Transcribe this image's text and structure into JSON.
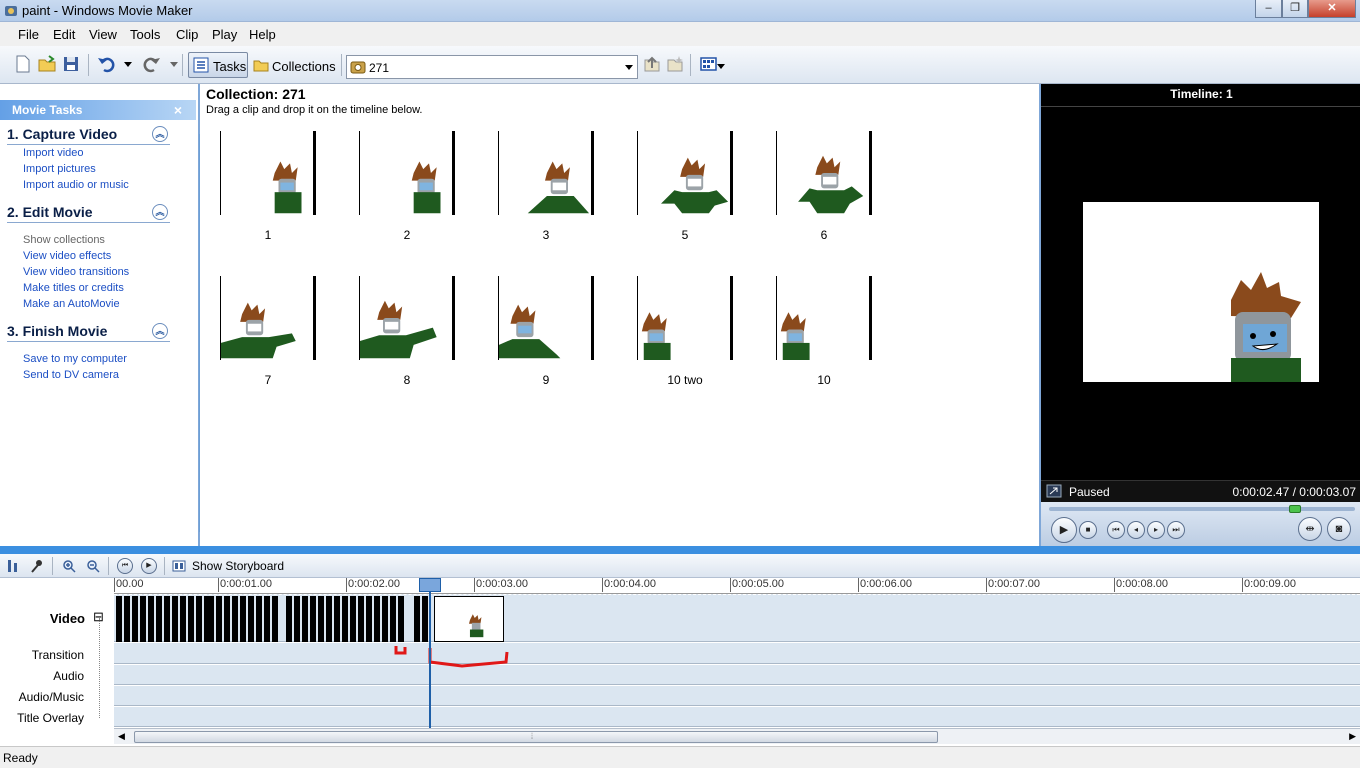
{
  "window": {
    "title": "paint - Windows Movie Maker"
  },
  "menu": [
    "File",
    "Edit",
    "View",
    "Tools",
    "Clip",
    "Play",
    "Help"
  ],
  "toolbar": {
    "tasks_label": "Tasks",
    "collections_label": "Collections",
    "collection_value": "271"
  },
  "task_pane": {
    "header": "Movie Tasks",
    "close": "×",
    "sections": [
      {
        "title": "1. Capture Video",
        "links": [
          "Import video",
          "Import pictures",
          "Import audio or music"
        ]
      },
      {
        "title": "2. Edit Movie",
        "links": [
          "Show collections",
          "View video effects",
          "View video transitions",
          "Make titles or credits",
          "Make an AutoMovie"
        ]
      },
      {
        "title": "3. Finish Movie",
        "links": [
          "Save to my computer",
          "Send to DV camera"
        ]
      }
    ]
  },
  "collection": {
    "title": "Collection: 271",
    "subtitle": "Drag a clip and drop it on the timeline below.",
    "clips": [
      "1",
      "2",
      "3",
      "5",
      "6",
      "7",
      "8",
      "9",
      "10 two",
      "10"
    ]
  },
  "monitor": {
    "title": "Timeline: 1",
    "status": "Paused",
    "time": "0:00:02.47 / 0:00:03.07"
  },
  "timeline_toolbar": {
    "storyboard_label": "Show Storyboard"
  },
  "timeline": {
    "ruler": [
      "00.00",
      "0:00:01.00",
      "0:00:02.00",
      "0:00:03.00",
      "0:00:04.00",
      "0:00:05.00",
      "0:00:06.00",
      "0:00:07.00",
      "0:00:08.00",
      "0:00:09.00"
    ],
    "tracks": {
      "video": "Video",
      "transition": "Transition",
      "audio": "Audio",
      "audio_music": "Audio/Music",
      "title_overlay": "Title Overlay"
    },
    "collapse": "⊟"
  },
  "status": {
    "text": "Ready"
  },
  "colors": {
    "accent": "#3b8fe0",
    "link": "#1c4fc4",
    "shirt": "#1f5a1f",
    "hair": "#8a4a1c",
    "annotation": "#e01818"
  },
  "icons": [
    "app-icon",
    "new-project-icon",
    "open-project-icon",
    "save-project-icon",
    "undo-icon",
    "redo-icon",
    "tasks-icon",
    "collections-folder-icon",
    "collection-icon",
    "up-level-icon",
    "new-folder-icon",
    "views-icon",
    "play-icon",
    "stop-icon",
    "split-icon",
    "snapshot-icon",
    "zoom-in-icon",
    "zoom-out-icon",
    "rewind-icon",
    "play-timeline-icon",
    "storyboard-icon"
  ]
}
